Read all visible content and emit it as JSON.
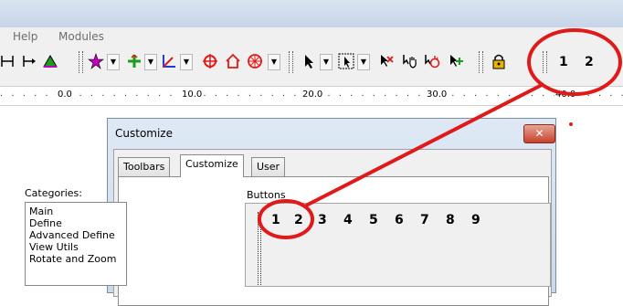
{
  "menubar": {
    "items": [
      "Help",
      "Modules"
    ]
  },
  "toolbar": {
    "numbers": [
      "1",
      "2"
    ],
    "icons": [
      "line-end-icon",
      "area-icon",
      "star-icon",
      "plus-icon",
      "axis-icon",
      "target-icon",
      "home-icon",
      "wheel-icon",
      "pointer-icon",
      "select-box-icon",
      "edit-icon",
      "hand-icon",
      "cursor-plus-icon",
      "lock-icon"
    ],
    "accent_colors": {
      "red": "#e01a1a",
      "green": "#1c9c1c",
      "magenta": "#c000c0",
      "blue": "#1f3fd0"
    }
  },
  "ruler": {
    "ticks": [
      "0.0",
      "10.0",
      "20.0",
      "30.0",
      "40.0"
    ]
  },
  "dialog": {
    "title": "Customize",
    "close_glyph": "✕",
    "tabs": [
      "Toolbars",
      "Customize",
      "User"
    ],
    "active_tab": "Customize",
    "categories_label": "Categories:",
    "categories": [
      "Main",
      "Define",
      "Advanced Define",
      "View Utils",
      "Rotate and Zoom"
    ],
    "buttons_label": "Buttons",
    "buttons": [
      "1",
      "2",
      "3",
      "4",
      "5",
      "6",
      "7",
      "8",
      "9"
    ]
  },
  "annotation": {
    "color": "#e01a1a"
  }
}
